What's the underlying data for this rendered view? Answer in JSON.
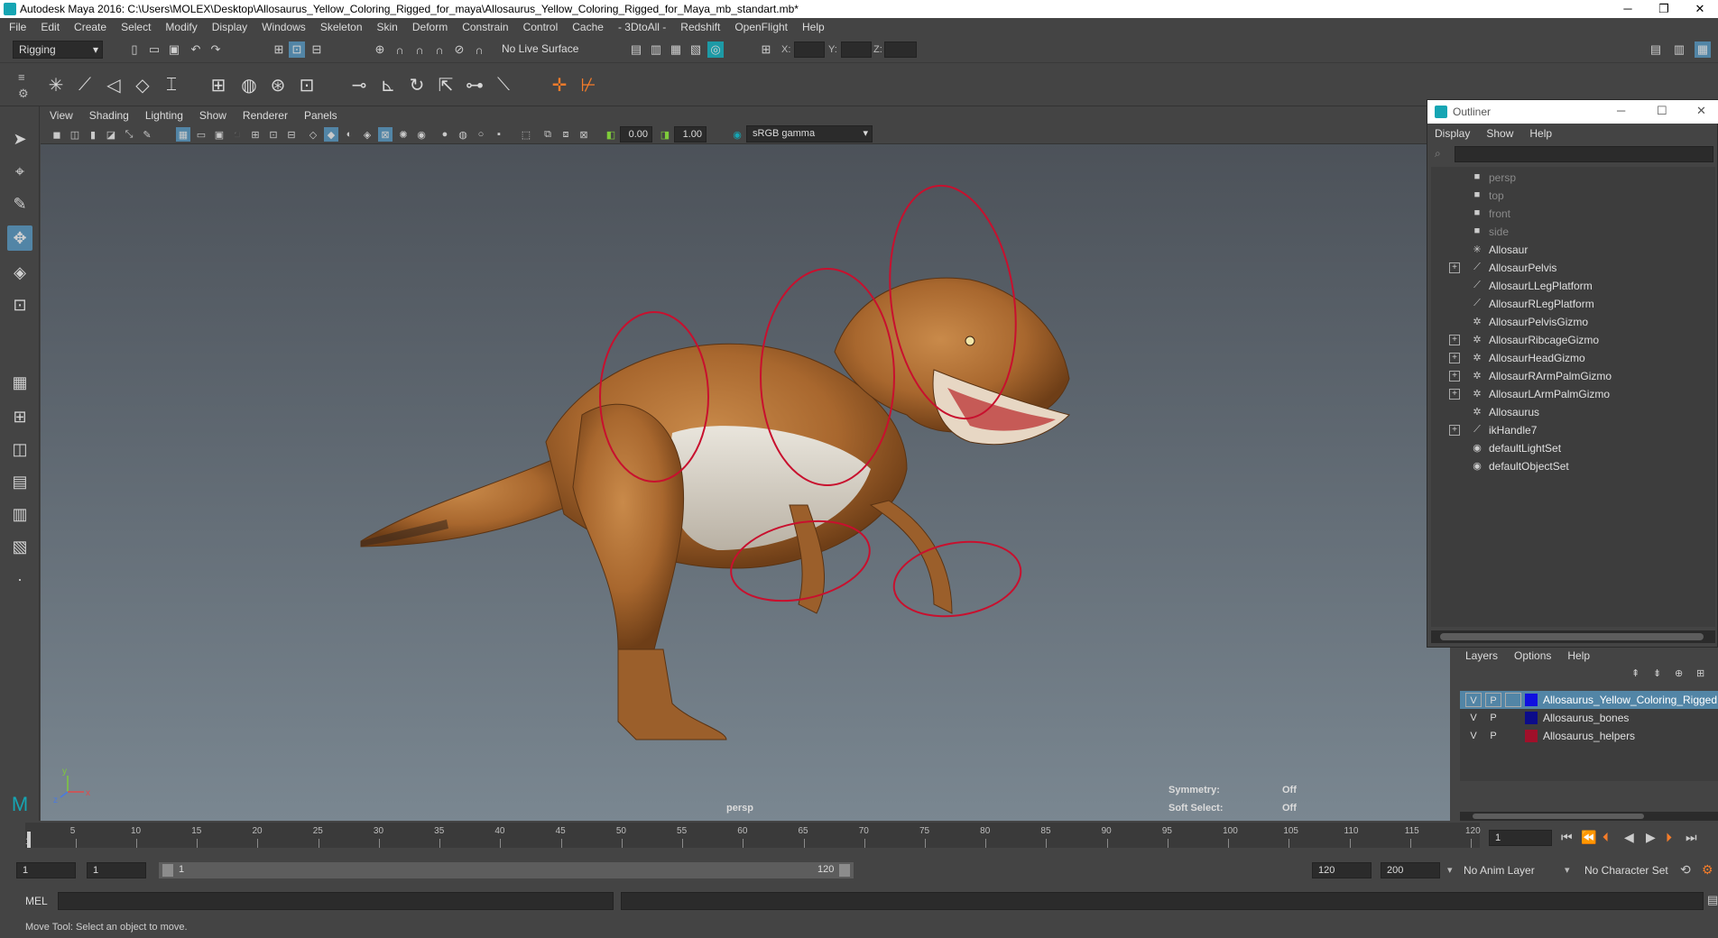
{
  "window": {
    "title": "Autodesk Maya 2016: C:\\Users\\MOLEX\\Desktop\\Allosaurus_Yellow_Coloring_Rigged_for_maya\\Allosaurus_Yellow_Coloring_Rigged_for_Maya_mb_standart.mb*",
    "minimize": "─",
    "restore": "❐",
    "close": "✕"
  },
  "menubar": [
    "File",
    "Edit",
    "Create",
    "Select",
    "Modify",
    "Display",
    "Windows",
    "Skeleton",
    "Skin",
    "Deform",
    "Constrain",
    "Control",
    "Cache",
    "- 3DtoAll -",
    "Redshift",
    "OpenFlight",
    "Help"
  ],
  "statusline": {
    "menuset": "Rigging",
    "live_surface": "No Live Surface",
    "x_label": "X:",
    "y_label": "Y:",
    "z_label": "Z:"
  },
  "viewport": {
    "menu": [
      "View",
      "Shading",
      "Lighting",
      "Show",
      "Renderer",
      "Panels"
    ],
    "near_clip": "0.00",
    "far_clip": "1.00",
    "color_space": "sRGB gamma",
    "camera_label": "persp",
    "hud": {
      "symmetry_label": "Symmetry:",
      "symmetry_value": "Off",
      "soft_select_label": "Soft Select:",
      "soft_select_value": "Off"
    },
    "axis_x": "x",
    "axis_y": "y",
    "axis_z": "z"
  },
  "outliner": {
    "title": "Outliner",
    "menu": [
      "Display",
      "Show",
      "Help"
    ],
    "items": [
      {
        "label": "persp",
        "icon": "camera-icon",
        "expandable": false,
        "dim": true
      },
      {
        "label": "top",
        "icon": "camera-icon",
        "expandable": false,
        "dim": true
      },
      {
        "label": "front",
        "icon": "camera-icon",
        "expandable": false,
        "dim": true
      },
      {
        "label": "side",
        "icon": "camera-icon",
        "expandable": false,
        "dim": true
      },
      {
        "label": "Allosaur",
        "icon": "locator-icon",
        "expandable": false,
        "dim": false
      },
      {
        "label": "AllosaurPelvis",
        "icon": "joint-icon",
        "expandable": true,
        "dim": false
      },
      {
        "label": "AllosaurLLegPlatform",
        "icon": "joint-icon",
        "expandable": false,
        "dim": false
      },
      {
        "label": "AllosaurRLegPlatform",
        "icon": "joint-icon",
        "expandable": false,
        "dim": false
      },
      {
        "label": "AllosaurPelvisGizmo",
        "icon": "curve-icon",
        "expandable": false,
        "dim": false
      },
      {
        "label": "AllosaurRibcageGizmo",
        "icon": "curve-icon",
        "expandable": true,
        "dim": false
      },
      {
        "label": "AllosaurHeadGizmo",
        "icon": "curve-icon",
        "expandable": true,
        "dim": false
      },
      {
        "label": "AllosaurRArmPalmGizmo",
        "icon": "curve-icon",
        "expandable": true,
        "dim": false
      },
      {
        "label": "AllosaurLArmPalmGizmo",
        "icon": "curve-icon",
        "expandable": true,
        "dim": false
      },
      {
        "label": "Allosaurus",
        "icon": "curve-icon",
        "expandable": false,
        "dim": false
      },
      {
        "label": "ikHandle7",
        "icon": "ik-icon",
        "expandable": true,
        "dim": false
      },
      {
        "label": "defaultLightSet",
        "icon": "set-icon",
        "expandable": false,
        "dim": false
      },
      {
        "label": "defaultObjectSet",
        "icon": "set-icon",
        "expandable": false,
        "dim": false
      }
    ]
  },
  "layers": {
    "menu": [
      "Layers",
      "Options",
      "Help"
    ],
    "rows": [
      {
        "v": "V",
        "p": "P",
        "color": "#1010e0",
        "name": "Allosaurus_Yellow_Coloring_Rigged",
        "selected": true
      },
      {
        "v": "V",
        "p": "P",
        "color": "#0c0c8a",
        "name": "Allosaurus_bones",
        "selected": false
      },
      {
        "v": "V",
        "p": "P",
        "color": "#a0102a",
        "name": "Allosaurus_helpers",
        "selected": false
      }
    ]
  },
  "timeslider": {
    "ticks": [
      "1",
      "5",
      "10",
      "15",
      "20",
      "25",
      "30",
      "35",
      "40",
      "45",
      "50",
      "55",
      "60",
      "65",
      "70",
      "75",
      "80",
      "85",
      "90",
      "95",
      "100",
      "105",
      "110",
      "115",
      "120"
    ],
    "current_frame": "1"
  },
  "rangeslider": {
    "start": "1",
    "playback_start": "1",
    "range_start_label": "1",
    "range_end_label": "120",
    "playback_end": "120",
    "end": "200",
    "anim_layer": "No Anim Layer",
    "character_set": "No Character Set"
  },
  "cmdline": {
    "label": "MEL"
  },
  "helpline": {
    "text": "Move Tool: Select an object to move."
  },
  "colors": {
    "accent": "#5285a6",
    "gizmo": "#c8102e",
    "selected_layer": "#5285a6"
  }
}
